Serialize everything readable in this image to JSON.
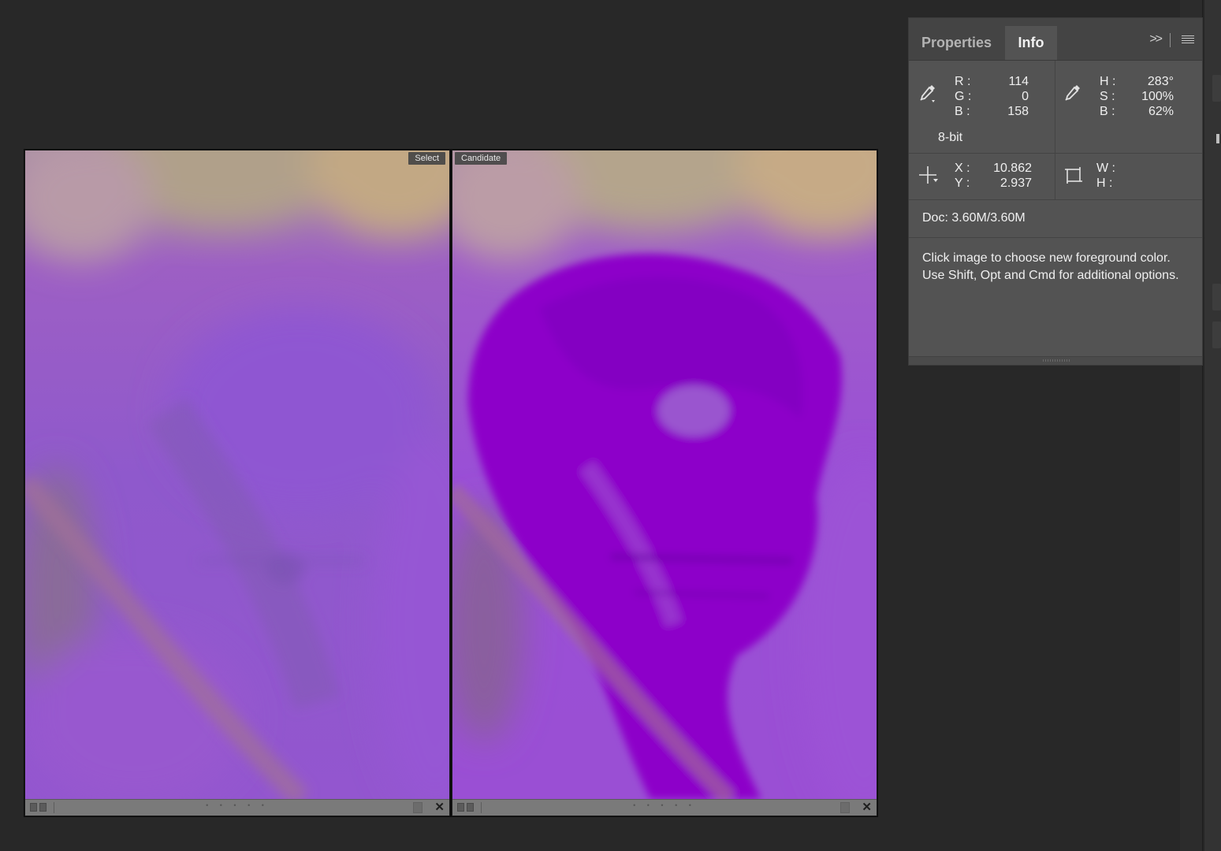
{
  "compare": {
    "select_label": "Select",
    "candidate_label": "Candidate"
  },
  "panel": {
    "tabs": [
      "Properties",
      "Info"
    ],
    "active_tab": "Info",
    "rgb": {
      "r_label": "R :",
      "r": "114",
      "g_label": "G :",
      "g": "0",
      "b_label": "B :",
      "b": "158"
    },
    "hsb": {
      "h_label": "H :",
      "h": "283°",
      "s_label": "S :",
      "s": "100%",
      "b_label": "B :",
      "b": "62%"
    },
    "bit_depth": "8-bit",
    "position": {
      "x_label": "X :",
      "x": "10.862",
      "y_label": "Y :",
      "y": "2.937"
    },
    "size": {
      "w_label": "W :",
      "w": "",
      "h_label": "H :",
      "h": ""
    },
    "doc": "Doc: 3.60M/3.60M",
    "hint": "Click image to choose new foreground color.  Use Shift, Opt and Cmd for additional options."
  },
  "colors": {
    "sampled": "#72009e",
    "panel_bg": "#535353",
    "workspace_bg": "#282828"
  },
  "icons": [
    "eyedropper-icon",
    "crosshair-icon",
    "selection-size-icon",
    "panel-menu-icon",
    "expand-chevron-icon",
    "close-icon",
    "flag-icon"
  ]
}
